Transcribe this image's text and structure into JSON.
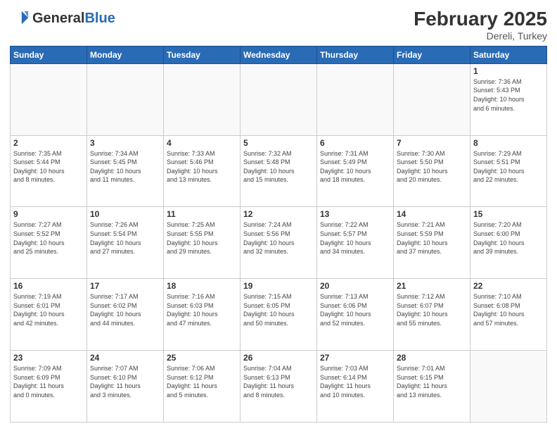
{
  "header": {
    "logo_general": "General",
    "logo_blue": "Blue",
    "month_year": "February 2025",
    "location": "Dereli, Turkey"
  },
  "days_of_week": [
    "Sunday",
    "Monday",
    "Tuesday",
    "Wednesday",
    "Thursday",
    "Friday",
    "Saturday"
  ],
  "weeks": [
    [
      {
        "num": "",
        "info": ""
      },
      {
        "num": "",
        "info": ""
      },
      {
        "num": "",
        "info": ""
      },
      {
        "num": "",
        "info": ""
      },
      {
        "num": "",
        "info": ""
      },
      {
        "num": "",
        "info": ""
      },
      {
        "num": "1",
        "info": "Sunrise: 7:36 AM\nSunset: 5:43 PM\nDaylight: 10 hours\nand 6 minutes."
      }
    ],
    [
      {
        "num": "2",
        "info": "Sunrise: 7:35 AM\nSunset: 5:44 PM\nDaylight: 10 hours\nand 8 minutes."
      },
      {
        "num": "3",
        "info": "Sunrise: 7:34 AM\nSunset: 5:45 PM\nDaylight: 10 hours\nand 11 minutes."
      },
      {
        "num": "4",
        "info": "Sunrise: 7:33 AM\nSunset: 5:46 PM\nDaylight: 10 hours\nand 13 minutes."
      },
      {
        "num": "5",
        "info": "Sunrise: 7:32 AM\nSunset: 5:48 PM\nDaylight: 10 hours\nand 15 minutes."
      },
      {
        "num": "6",
        "info": "Sunrise: 7:31 AM\nSunset: 5:49 PM\nDaylight: 10 hours\nand 18 minutes."
      },
      {
        "num": "7",
        "info": "Sunrise: 7:30 AM\nSunset: 5:50 PM\nDaylight: 10 hours\nand 20 minutes."
      },
      {
        "num": "8",
        "info": "Sunrise: 7:29 AM\nSunset: 5:51 PM\nDaylight: 10 hours\nand 22 minutes."
      }
    ],
    [
      {
        "num": "9",
        "info": "Sunrise: 7:27 AM\nSunset: 5:52 PM\nDaylight: 10 hours\nand 25 minutes."
      },
      {
        "num": "10",
        "info": "Sunrise: 7:26 AM\nSunset: 5:54 PM\nDaylight: 10 hours\nand 27 minutes."
      },
      {
        "num": "11",
        "info": "Sunrise: 7:25 AM\nSunset: 5:55 PM\nDaylight: 10 hours\nand 29 minutes."
      },
      {
        "num": "12",
        "info": "Sunrise: 7:24 AM\nSunset: 5:56 PM\nDaylight: 10 hours\nand 32 minutes."
      },
      {
        "num": "13",
        "info": "Sunrise: 7:22 AM\nSunset: 5:57 PM\nDaylight: 10 hours\nand 34 minutes."
      },
      {
        "num": "14",
        "info": "Sunrise: 7:21 AM\nSunset: 5:59 PM\nDaylight: 10 hours\nand 37 minutes."
      },
      {
        "num": "15",
        "info": "Sunrise: 7:20 AM\nSunset: 6:00 PM\nDaylight: 10 hours\nand 39 minutes."
      }
    ],
    [
      {
        "num": "16",
        "info": "Sunrise: 7:19 AM\nSunset: 6:01 PM\nDaylight: 10 hours\nand 42 minutes."
      },
      {
        "num": "17",
        "info": "Sunrise: 7:17 AM\nSunset: 6:02 PM\nDaylight: 10 hours\nand 44 minutes."
      },
      {
        "num": "18",
        "info": "Sunrise: 7:16 AM\nSunset: 6:03 PM\nDaylight: 10 hours\nand 47 minutes."
      },
      {
        "num": "19",
        "info": "Sunrise: 7:15 AM\nSunset: 6:05 PM\nDaylight: 10 hours\nand 50 minutes."
      },
      {
        "num": "20",
        "info": "Sunrise: 7:13 AM\nSunset: 6:06 PM\nDaylight: 10 hours\nand 52 minutes."
      },
      {
        "num": "21",
        "info": "Sunrise: 7:12 AM\nSunset: 6:07 PM\nDaylight: 10 hours\nand 55 minutes."
      },
      {
        "num": "22",
        "info": "Sunrise: 7:10 AM\nSunset: 6:08 PM\nDaylight: 10 hours\nand 57 minutes."
      }
    ],
    [
      {
        "num": "23",
        "info": "Sunrise: 7:09 AM\nSunset: 6:09 PM\nDaylight: 11 hours\nand 0 minutes."
      },
      {
        "num": "24",
        "info": "Sunrise: 7:07 AM\nSunset: 6:10 PM\nDaylight: 11 hours\nand 3 minutes."
      },
      {
        "num": "25",
        "info": "Sunrise: 7:06 AM\nSunset: 6:12 PM\nDaylight: 11 hours\nand 5 minutes."
      },
      {
        "num": "26",
        "info": "Sunrise: 7:04 AM\nSunset: 6:13 PM\nDaylight: 11 hours\nand 8 minutes."
      },
      {
        "num": "27",
        "info": "Sunrise: 7:03 AM\nSunset: 6:14 PM\nDaylight: 11 hours\nand 10 minutes."
      },
      {
        "num": "28",
        "info": "Sunrise: 7:01 AM\nSunset: 6:15 PM\nDaylight: 11 hours\nand 13 minutes."
      },
      {
        "num": "",
        "info": ""
      }
    ]
  ]
}
